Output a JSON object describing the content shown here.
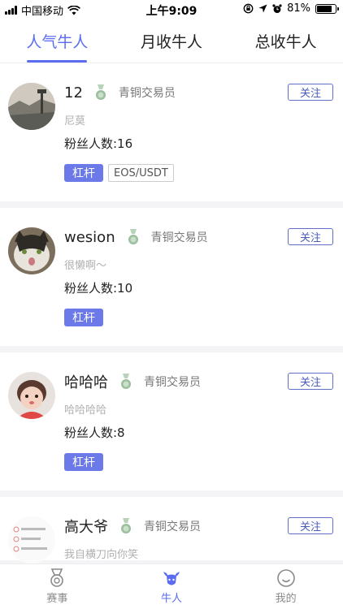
{
  "status": {
    "carrier": "中国移动",
    "time": "上午9:09",
    "battery_text": "81%",
    "battery_level": 0.81
  },
  "tabs": [
    {
      "label": "人气牛人",
      "active": true
    },
    {
      "label": "月收牛人",
      "active": false
    },
    {
      "label": "总收牛人",
      "active": false
    }
  ],
  "traders": [
    {
      "name": "12",
      "level": "青铜交易员",
      "bio": "尼莫",
      "fans": "粉丝人数:16",
      "tags": [
        "杠杆",
        "EOS/USDT"
      ],
      "follow": "关注",
      "avatar_icon": "landscape-avatar"
    },
    {
      "name": "wesion",
      "level": "青铜交易员",
      "bio": "很懒啊～",
      "fans": "粉丝人数:10",
      "tags": [
        "杠杆"
      ],
      "follow": "关注",
      "avatar_icon": "cat-avatar"
    },
    {
      "name": "哈哈哈",
      "level": "青铜交易员",
      "bio": "哈哈哈哈",
      "fans": "粉丝人数:8",
      "tags": [
        "杠杆"
      ],
      "follow": "关注",
      "avatar_icon": "child-avatar"
    },
    {
      "name": "高大爷",
      "level": "青铜交易员",
      "bio": "我自横刀向你笑",
      "fans": "",
      "tags": [],
      "follow": "关注",
      "avatar_icon": "document-avatar"
    }
  ],
  "bottom_nav": [
    {
      "label": "赛事",
      "icon": "medal-icon",
      "active": false
    },
    {
      "label": "牛人",
      "icon": "bull-icon",
      "active": true
    },
    {
      "label": "我的",
      "icon": "smiley-icon",
      "active": false
    }
  ],
  "colors": {
    "accent": "#5b6cf0",
    "tag_bg": "#6b7ae8",
    "medal": "#9bbf9e"
  }
}
